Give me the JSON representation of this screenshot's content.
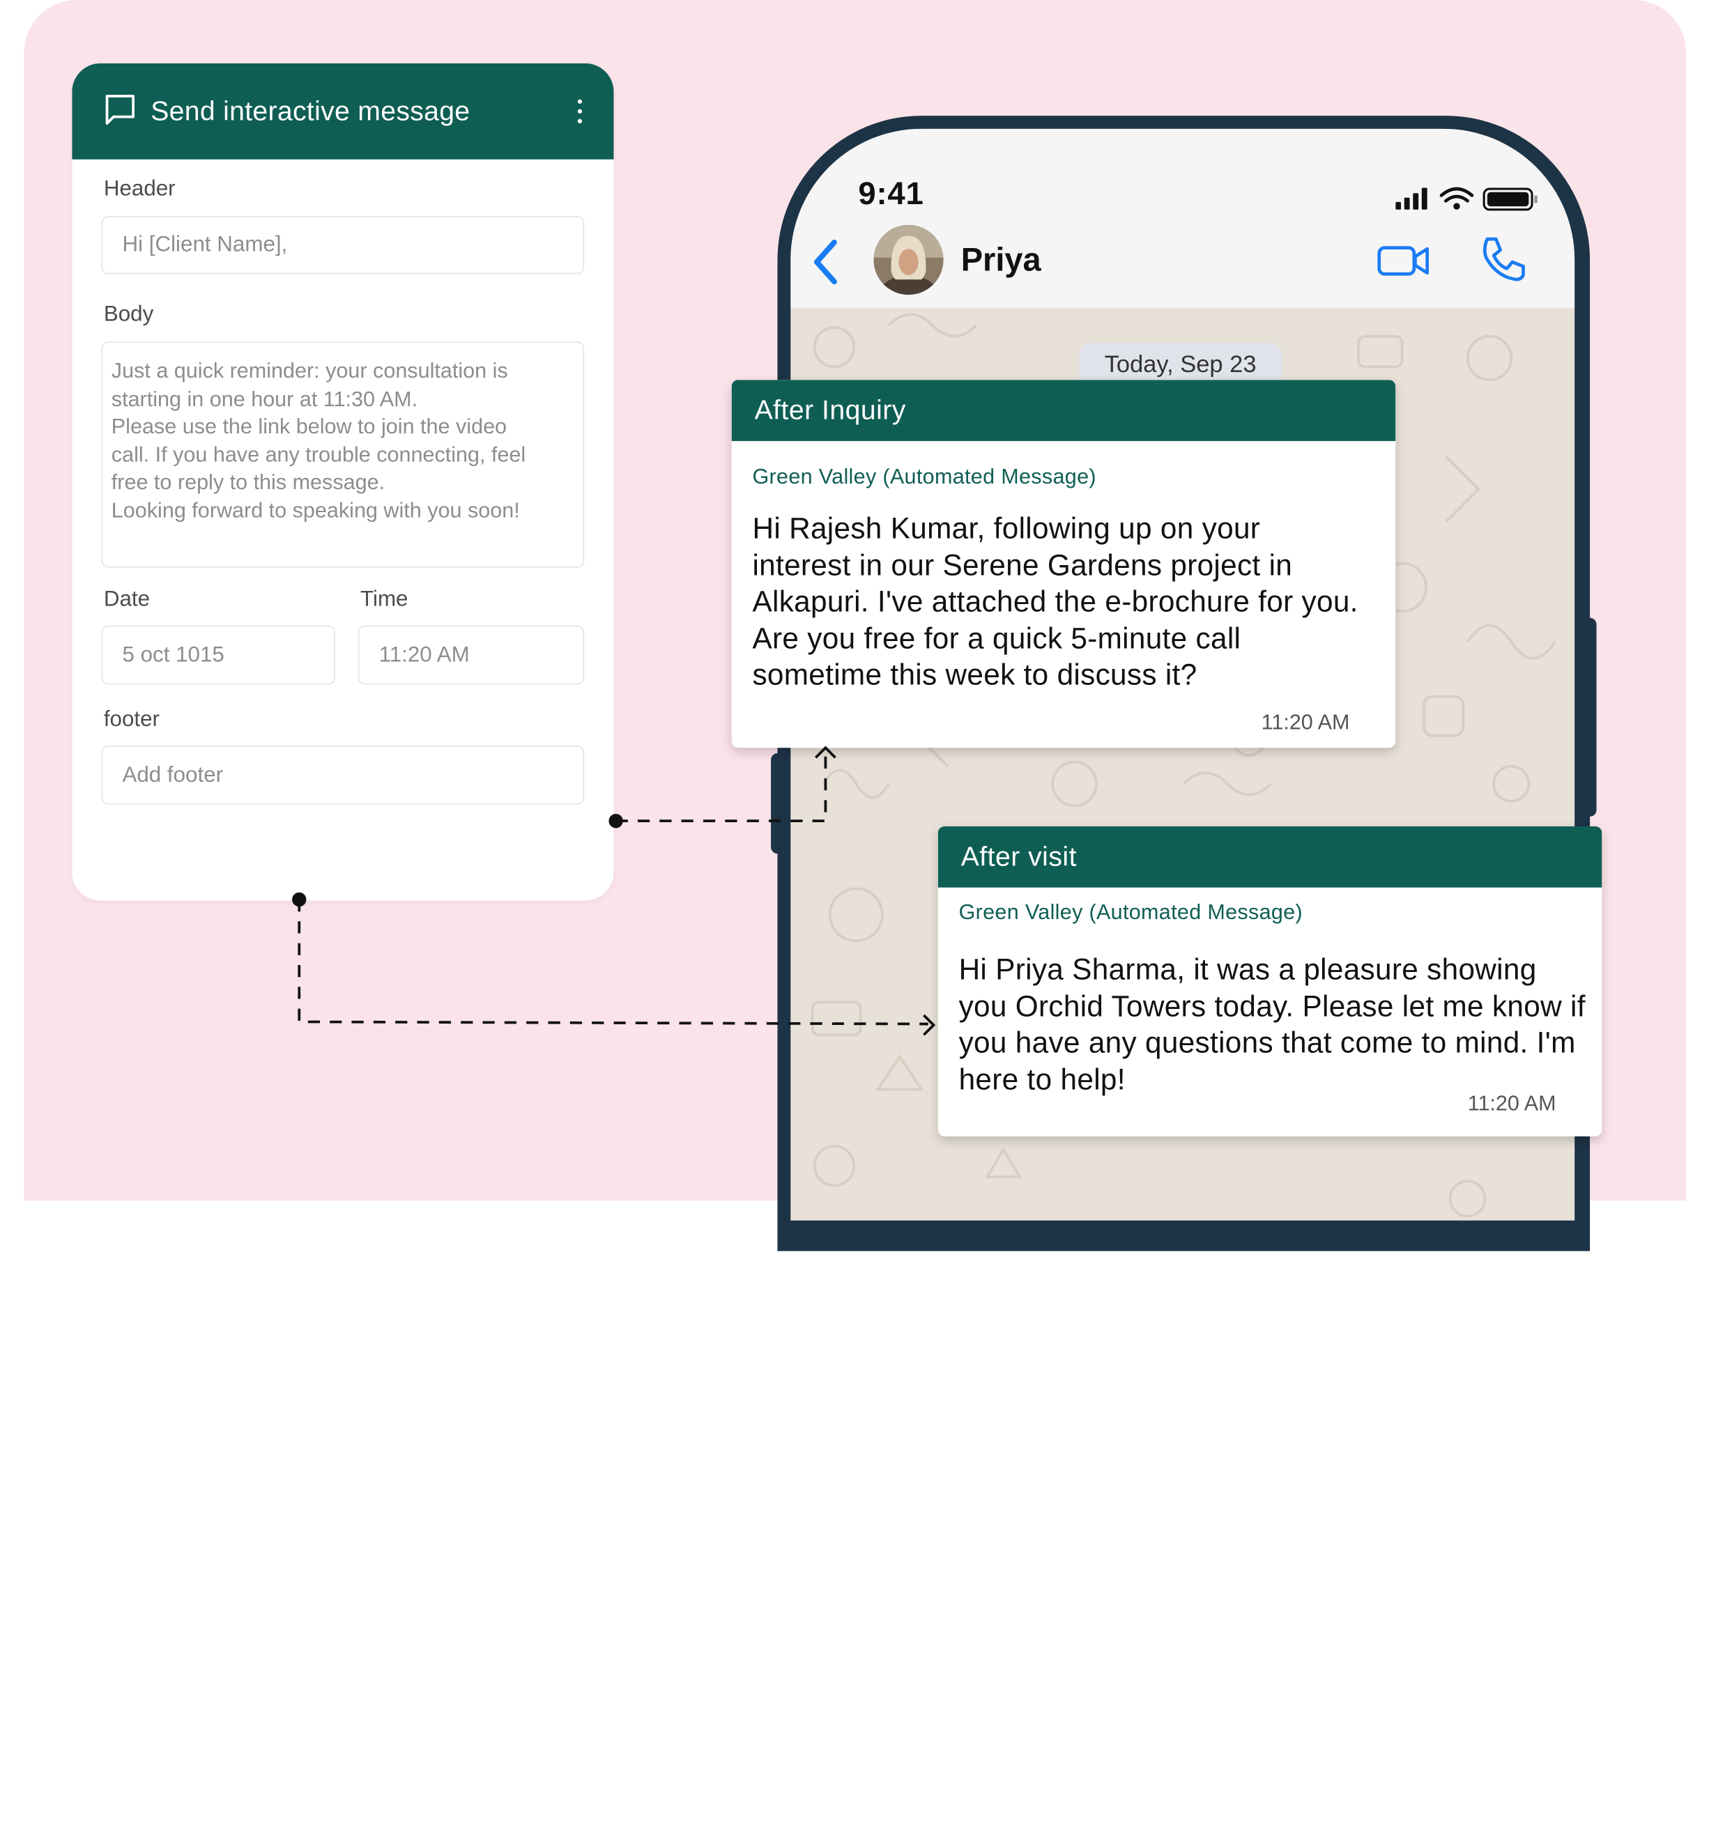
{
  "form": {
    "title": "Send interactive message",
    "header_label": "Header",
    "header_placeholder": "Hi [Client Name],",
    "body_label": "Body",
    "body_text": "Just a quick reminder: your consultation is\nstarting in one hour at 11:30 AM.\nPlease use the link below to join the video\ncall. If you have any trouble connecting, feel\nfree to reply to this message.\nLooking forward to speaking with you soon!",
    "date_label": "Date",
    "date_value": "5 oct 1015",
    "time_label": "Time",
    "time_value": "11:20 AM",
    "footer_label": "footer",
    "footer_placeholder": "Add footer"
  },
  "phone": {
    "status_time": "9:41",
    "contact_name": "Priya",
    "date_divider": "Today, Sep 23",
    "accent_color": "#1a7cf2"
  },
  "messages": [
    {
      "title": "After Inquiry",
      "sender": "Green Valley (Automated Message)",
      "body": "Hi Rajesh Kumar, following up on your interest in our Serene Gardens project in Alkapuri. I've attached the e-brochure for you. Are you free for a quick 5-minute call sometime this week to discuss it?",
      "time": "11:20 AM"
    },
    {
      "title": "After visit",
      "sender": "Green Valley (Automated Message)",
      "body": "Hi Priya Sharma, it was a pleasure showing you Orchid Towers today. Please let me know if you have any questions that come to mind. I'm here to help!",
      "time": "11:20 AM"
    }
  ],
  "colors": {
    "brand_green": "#0f5e54",
    "background_pink": "#fae3e9",
    "phone_frame": "#1d3346"
  }
}
